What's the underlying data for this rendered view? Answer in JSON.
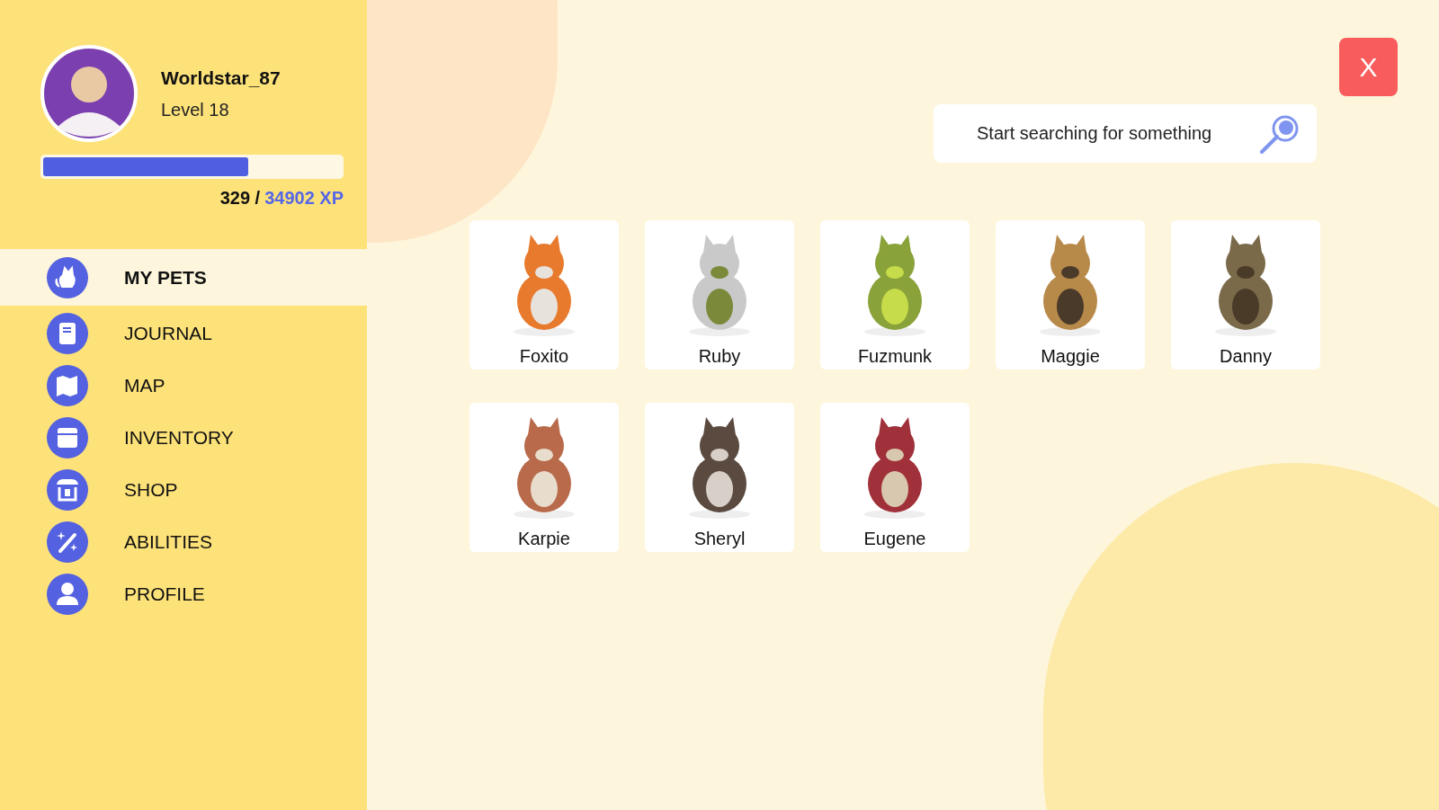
{
  "profile": {
    "username": "Worldstar_87",
    "level_label": "Level 18",
    "xp": {
      "level": 0.69,
      "current": "329 /",
      "total": "34902 XP"
    }
  },
  "nav": [
    {
      "label": "MY PETS",
      "selected": true
    },
    {
      "label": "JOURNAL",
      "selected": false
    },
    {
      "label": "MAP",
      "selected": false
    },
    {
      "label": "INVENTORY",
      "selected": false
    },
    {
      "label": "SHOP",
      "selected": false
    },
    {
      "label": "ABILITIES",
      "selected": false
    },
    {
      "label": "PROFILE",
      "selected": false
    }
  ],
  "search": {
    "placeholder": "Start searching for something"
  },
  "close_button": "X",
  "pets": [
    {
      "name": "Foxito"
    },
    {
      "name": "Ruby"
    },
    {
      "name": "Fuzmunk"
    },
    {
      "name": "Maggie"
    },
    {
      "name": "Danny"
    },
    {
      "name": "Karpie"
    },
    {
      "name": "Sheryl"
    },
    {
      "name": "Eugene"
    }
  ]
}
